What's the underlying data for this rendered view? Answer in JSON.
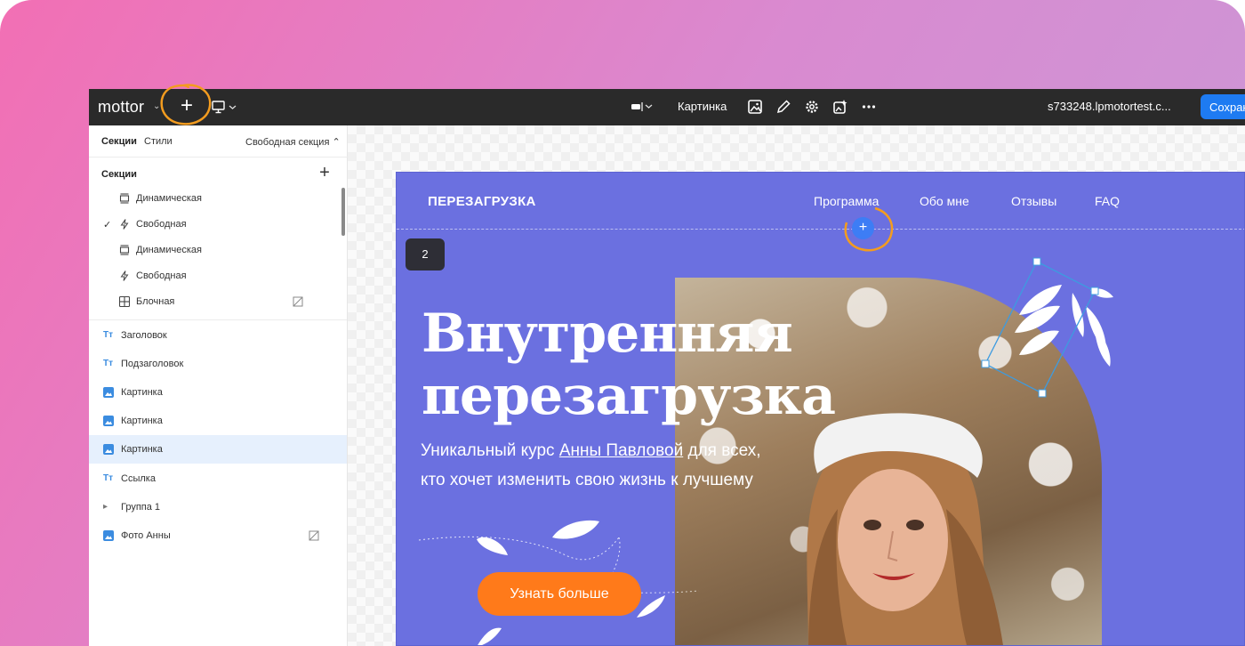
{
  "topbar": {
    "logo": "mottor",
    "add_label": "+",
    "element_label": "Картинка",
    "site_url": "s733248.lpmotortest.c...",
    "save_label": "Сохран"
  },
  "sidebar": {
    "tabs": {
      "sections": "Секции",
      "styles": "Стили",
      "section_type": "Свободная секция ⌃"
    },
    "sections_title": "Секции",
    "sections_add": "+",
    "sections": [
      {
        "label": "Динамическая",
        "icon": "dynamic-section-icon",
        "checked": false
      },
      {
        "label": "Свободная",
        "icon": "lightning-icon",
        "checked": true
      },
      {
        "label": "Динамическая",
        "icon": "dynamic-section-icon",
        "checked": false
      },
      {
        "label": "Свободная",
        "icon": "lightning-icon",
        "checked": false
      },
      {
        "label": "Блочная",
        "icon": "grid-icon",
        "checked": false
      }
    ],
    "checkmark": "✓",
    "layers": [
      {
        "label": "Заголовок",
        "icon": "text-icon",
        "icon_text": "Tт"
      },
      {
        "label": "Подзаголовок",
        "icon": "text-icon",
        "icon_text": "Tт"
      },
      {
        "label": "Картинка",
        "icon": "image-icon"
      },
      {
        "label": "Картинка",
        "icon": "image-icon"
      },
      {
        "label": "Картинка",
        "icon": "image-icon",
        "selected": true
      },
      {
        "label": "Ссылка",
        "icon": "text-icon",
        "icon_text": "Tт"
      },
      {
        "label": "Группа 1",
        "icon": "caret-right-icon",
        "icon_text": "▸"
      },
      {
        "label": "Фото Анны",
        "icon": "image-icon"
      }
    ]
  },
  "page": {
    "brand": "ПЕРЕЗАГРУЗКА",
    "nav": [
      "Программа",
      "Обо мне",
      "Отзывы",
      "FAQ"
    ],
    "section_number": "2",
    "add_block": "+",
    "headline_line1": "Внутренняя",
    "headline_line2": "перезагрузка",
    "subtitle_part1": "Уникальный курс ",
    "subtitle_link": "Анны Павловой",
    "subtitle_part2": " для всех,",
    "subtitle_line2": "кто хочет изменить свою жизнь к лучшему",
    "cta": "Узнать больше"
  },
  "colors": {
    "topbar": "#2a2a2a",
    "page_bg": "#6b70e0",
    "cta": "#ff7a1a",
    "accent_blue": "#1e7bf2",
    "highlight": "#f39c1f"
  }
}
